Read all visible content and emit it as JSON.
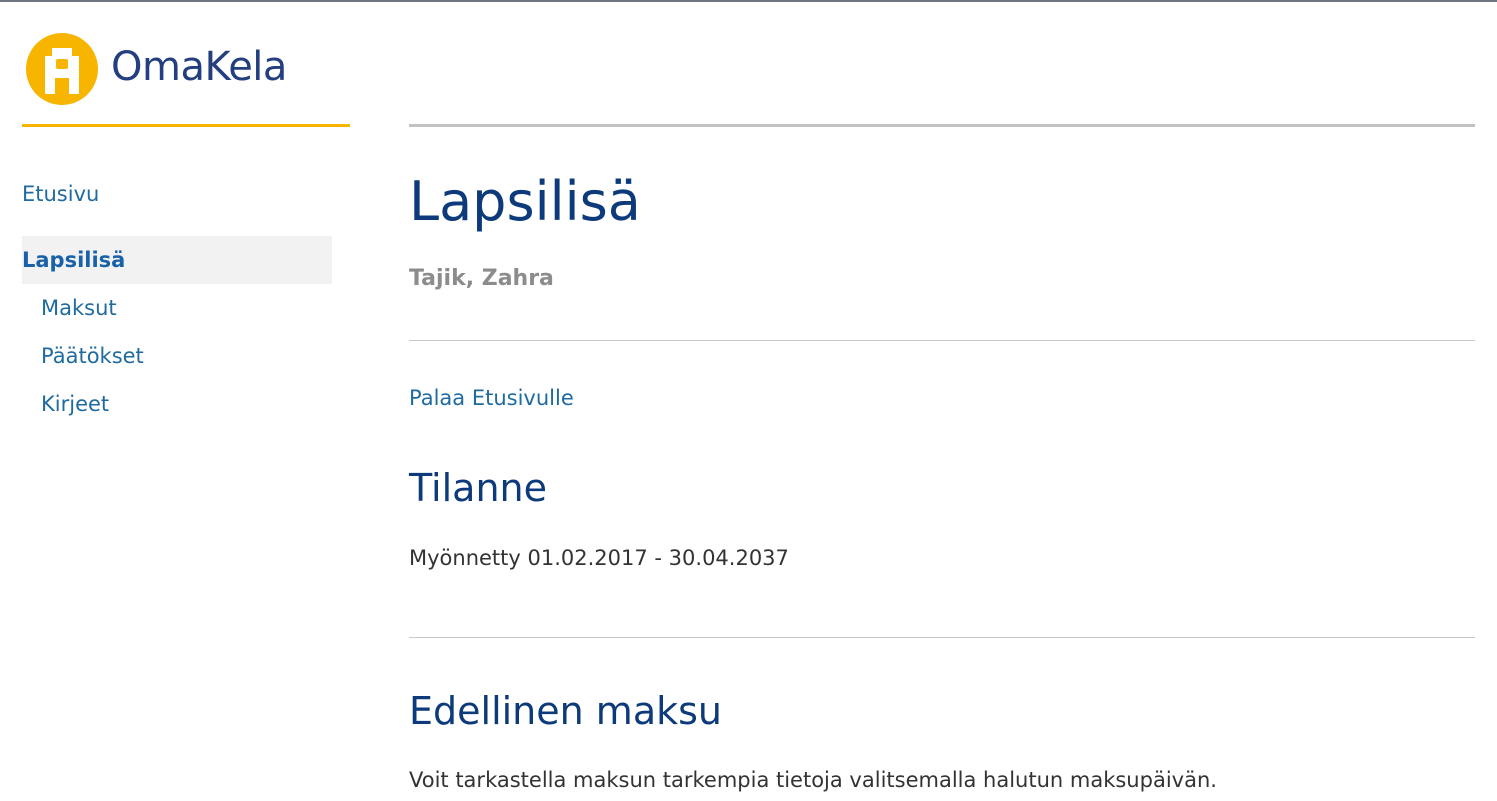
{
  "brand": {
    "name": "OmaKela",
    "accent_color": "#f7b500",
    "text_color": "#243f7f",
    "logo_icon": "kela-tower-icon"
  },
  "sidebar": {
    "items": [
      {
        "label": "Etusivu",
        "active": false,
        "sub": false
      },
      {
        "label": "Lapsilisä",
        "active": true,
        "sub": false
      },
      {
        "label": "Maksut",
        "active": false,
        "sub": true
      },
      {
        "label": "Päätökset",
        "active": false,
        "sub": true
      },
      {
        "label": "Kirjeet",
        "active": false,
        "sub": true
      }
    ]
  },
  "main": {
    "title": "Lapsilisä",
    "person_name": "Tajik, Zahra",
    "back_link": "Palaa Etusivulle",
    "status_section": {
      "heading": "Tilanne",
      "text": "Myönnetty 01.02.2017 - 30.04.2037"
    },
    "payment_section": {
      "heading": "Edellinen maksu",
      "text": "Voit tarkastella maksun tarkempia tietoja valitsemalla halutun maksupäivän."
    }
  },
  "colors": {
    "heading": "#0d3a7a",
    "link": "#1f6b9f",
    "muted": "#8c8c8c",
    "active_bg": "#f2f2f2"
  }
}
